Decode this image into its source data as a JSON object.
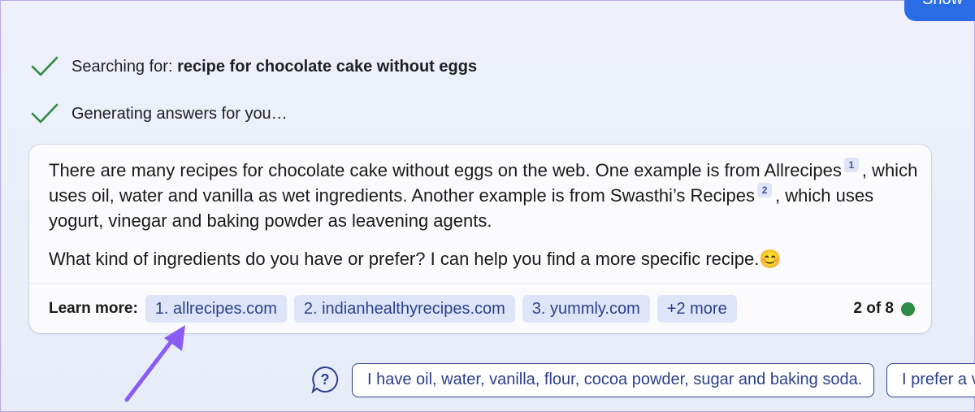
{
  "top_button": {
    "label": "Show"
  },
  "status": [
    {
      "icon": "checkmark-icon",
      "prefix": "Searching for: ",
      "query": "recipe for chocolate cake without eggs"
    },
    {
      "icon": "checkmark-icon",
      "text": "Generating answers for you…"
    }
  ],
  "answer": {
    "p1_a": "There are many recipes for chocolate cake without eggs on the web. One example is from Allrecipes",
    "cite1": "1",
    "p1_b": ", which uses oil, water and vanilla as wet ingredients. Another example is from Swasthi’s Recipes",
    "cite2": "2",
    "p1_c": ", which uses yogurt, vinegar and baking powder as leavening agents.",
    "p2": "What kind of ingredients do you have or prefer? I can help you find a more specific recipe.",
    "emoji": "😊"
  },
  "learn_more": {
    "label": "Learn more:",
    "sources": [
      "1. allrecipes.com",
      "2. indianhealthyrecipes.com",
      "3. yummly.com",
      "+2 more"
    ],
    "page_indicator": "2 of 8"
  },
  "suggestions": [
    "I have oil, water, vanilla, flour, cocoa powder, sugar and baking soda.",
    "I prefer a v"
  ],
  "colors": {
    "accent_blue": "#2a6be6",
    "check_green": "#2e8b3e",
    "chip_bg": "#dfe5f8",
    "chip_text": "#2b3f8c",
    "status_dot": "#2d8a45",
    "annotation_arrow": "#8a5cf5"
  }
}
